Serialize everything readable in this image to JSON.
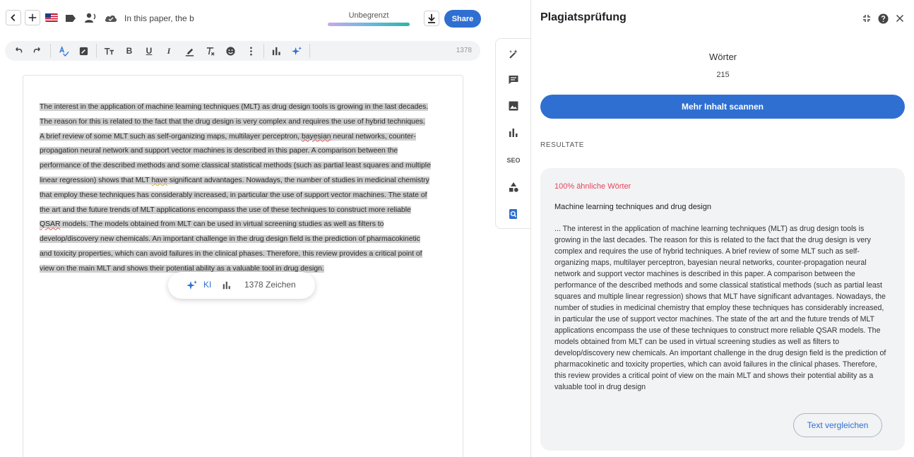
{
  "header": {
    "doc_title": "In this paper, the b",
    "plan_label": "Unbegrenzt",
    "share_label": "Share"
  },
  "toolbar": {
    "char_count": "1378"
  },
  "editor": {
    "lines": [
      "The interest in the application of machine learning techniques (MLT) as drug design tools is growing in the last decades.",
      "The reason for this is related to the fact that the drug design is very complex and requires the use of hybrid techniques.",
      "A brief review of some MLT such as self-organizing maps, multilayer perceptron, ",
      "bayesian",
      " neural networks, counter-",
      "propagation neural network and support vector machines is described in this paper. A comparison between the",
      "performance of the described methods and some classical statistical methods (such as partial least squares and multiple",
      "linear regression) shows that MLT ",
      "have",
      " significant advantages. Nowadays, the number of studies in medicinal chemistry",
      "that employ these techniques has considerably increased, in particular the use of support vector machines. The state of",
      "the art and the future trends of MLT applications encompass the use of these techniques to construct more reliable",
      "QSAR",
      " models. The models obtained from MLT can be used in virtual screening studies as well as filters to",
      "develop/discovery new chemicals. An important challenge in the drug design field is the prediction of pharmacokinetic",
      "and toxicity properties, which can avoid failures in the clinical phases. Therefore, this review provides a critical point of",
      "view on the main MLT and shows their potential ability as a valuable tool in drug design."
    ],
    "pill_ki": "KI",
    "pill_zeichen": "1378 Zeichen"
  },
  "rail": {
    "seo_label": "SEO"
  },
  "panel": {
    "title": "Plagiatsprüfung",
    "woerter_label": "Wörter",
    "woerter_count": "215",
    "scan_button": "Mehr Inhalt scannen",
    "results_label": "RESULTATE",
    "result": {
      "similarity": "100% ähnliche Wörter",
      "source_title": "Machine learning techniques and drug design",
      "excerpt": "... The interest in the application of machine learning techniques (MLT) as drug design tools is growing in the last decades. The reason for this is related to the fact that the drug design is very complex and requires the use of hybrid techniques. A brief review of some MLT such as self-organizing maps, multilayer perceptron, bayesian neural networks, counter-propagation neural network and support vector machines is described in this paper. A comparison between the performance of the described methods and some classical statistical methods (such as partial least squares and multiple linear regression) shows that MLT have significant advantages. Nowadays, the number of studies in medicinal chemistry that employ these techniques has considerably increased, in particular the use of support vector machines. The state of the art and the future trends of MLT applications encompass the use of these techniques to construct more reliable QSAR models. The models obtained from MLT can be used in virtual screening studies as well as filters to develop/discovery new chemicals. An important challenge in the drug design field is the prediction of pharmacokinetic and toxicity properties, which can avoid failures in the clinical phases. Therefore, this review provides a critical point of view on the main MLT and shows their potential ability as a valuable tool in drug design",
      "compare_button": "Text vergleichen"
    }
  },
  "colors": {
    "accent": "#2f6fd1",
    "similarity": "#e8435a",
    "highlight": "#cfcfcf"
  }
}
